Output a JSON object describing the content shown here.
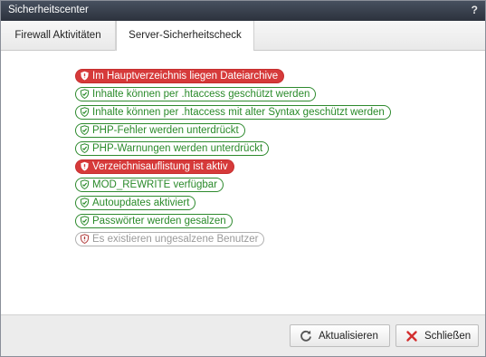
{
  "window": {
    "title": "Sicherheitscenter",
    "help_label": "?"
  },
  "tabs": [
    {
      "label": "Firewall Aktivitäten",
      "active": false
    },
    {
      "label": "Server-Sicherheitscheck",
      "active": true
    }
  ],
  "checks": [
    {
      "status": "bad",
      "label": "Im Hauptverzeichnis liegen Dateiarchive",
      "icon": "shield-alert-icon"
    },
    {
      "status": "ok",
      "label": "Inhalte können per .htaccess geschützt werden",
      "icon": "shield-check-icon"
    },
    {
      "status": "ok",
      "label": "Inhalte können per .htaccess mit alter Syntax geschützt werden",
      "icon": "shield-check-icon"
    },
    {
      "status": "ok",
      "label": "PHP-Fehler werden unterdrückt",
      "icon": "shield-check-icon"
    },
    {
      "status": "ok",
      "label": "PHP-Warnungen werden unterdrückt",
      "icon": "shield-check-icon"
    },
    {
      "status": "bad",
      "label": "Verzeichnisauflistung ist aktiv",
      "icon": "shield-alert-icon"
    },
    {
      "status": "ok",
      "label": "MOD_REWRITE verfügbar",
      "icon": "shield-check-icon"
    },
    {
      "status": "ok",
      "label": "Autoupdates aktiviert",
      "icon": "shield-check-icon"
    },
    {
      "status": "ok",
      "label": "Passwörter werden gesalzen",
      "icon": "shield-check-icon"
    },
    {
      "status": "inactive",
      "label": "Es existieren ungesalzene Benutzer",
      "icon": "shield-alert-icon"
    }
  ],
  "footer": {
    "refresh_label": "Aktualisieren",
    "close_label": "Schließen"
  },
  "colors": {
    "ok": "#2a8a2a",
    "bad": "#d63a3a",
    "inactive": "#9a9a9a",
    "titlebar": "#3a414d"
  }
}
